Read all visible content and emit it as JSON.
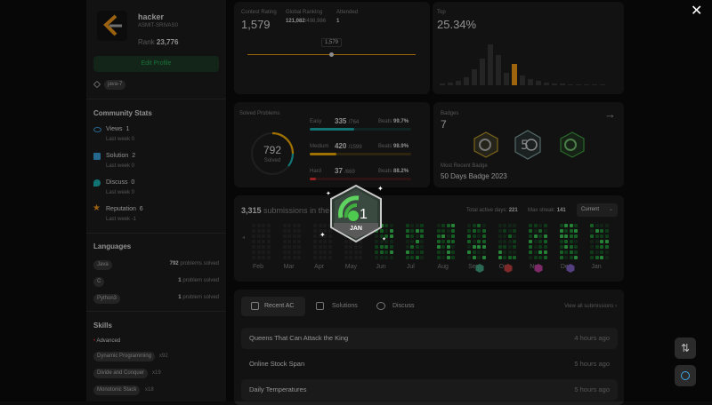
{
  "profile": {
    "name": "hacker",
    "username": "ASMIT-SRIVAS0",
    "rank_label": "Rank",
    "rank": "23,776",
    "edit": "Edit Profile",
    "tag": "java-7"
  },
  "community": {
    "title": "Community Stats",
    "items": [
      {
        "label": "Views",
        "value": "1",
        "sub": "Last week 0"
      },
      {
        "label": "Solution",
        "value": "2",
        "sub": "Last week 0"
      },
      {
        "label": "Discuss",
        "value": "0",
        "sub": "Last week 0"
      },
      {
        "label": "Reputation",
        "value": "6",
        "sub": "Last week -1"
      }
    ]
  },
  "languages": {
    "title": "Languages",
    "items": [
      {
        "name": "Java",
        "count": "792",
        "suffix": "problems solved"
      },
      {
        "name": "C",
        "count": "1",
        "suffix": "problem solved"
      },
      {
        "name": "Python3",
        "count": "1",
        "suffix": "problem solved"
      }
    ]
  },
  "skills": {
    "title": "Skills",
    "level": "Advanced",
    "items": [
      {
        "name": "Dynamic Programming",
        "count": "x92"
      },
      {
        "name": "Divide and Conquer",
        "count": "x19"
      },
      {
        "name": "Monotonic Stack",
        "count": "x18"
      }
    ]
  },
  "contest": {
    "rating_label": "Contest Rating",
    "rating": "1,579",
    "global_label": "Global Ranking",
    "global": "121,082",
    "global_total": "/498,986",
    "attended_label": "Attended",
    "attended": "1",
    "tooltip": "1,579"
  },
  "top": {
    "label": "Top",
    "value": "25.34%"
  },
  "solved": {
    "title": "Solved Problems",
    "total": "792",
    "total_label": "Solved",
    "beats_label": "Beats",
    "levels": [
      {
        "name": "Easy",
        "count": "335",
        "total": "/764",
        "beats": "99.7%",
        "color": "#1cbaba",
        "fill": 0.44
      },
      {
        "name": "Medium",
        "count": "420",
        "total": "/1599",
        "beats": "98.9%",
        "color": "#ffb700",
        "fill": 0.26
      },
      {
        "name": "Hard",
        "count": "37",
        "total": "/669",
        "beats": "88.2%",
        "color": "#f63737",
        "fill": 0.06
      }
    ]
  },
  "badges": {
    "title": "Badges",
    "count": "7",
    "recent_label": "Most Recent Badge",
    "recent": "50 Days Badge 2023"
  },
  "popup": {
    "number": "1",
    "month": "JAN"
  },
  "submissions": {
    "count": "3,315",
    "title": "submissions in the",
    "active_label": "Total active days:",
    "active": "221",
    "streak_label": "Max streak:",
    "streak": "141",
    "select": "Current",
    "months": [
      "Feb",
      "Mar",
      "Apr",
      "May",
      "Jun",
      "Jul",
      "Aug",
      "Sep",
      "Oct",
      "Nov",
      "Dec",
      "Jan"
    ]
  },
  "recent": {
    "tabs": [
      "Recent AC",
      "Solutions",
      "Discuss"
    ],
    "view_all": "View all submissions",
    "rows": [
      {
        "title": "Queens That Can Attack the King",
        "time": "4 hours ago"
      },
      {
        "title": "Online Stock Span",
        "time": "5 hours ago"
      },
      {
        "title": "Daily Temperatures",
        "time": "5 hours ago"
      }
    ]
  },
  "colors": {
    "accent": "#2cbb5d",
    "easy": "#1cbaba",
    "medium": "#ffb700",
    "hard": "#f63737"
  }
}
